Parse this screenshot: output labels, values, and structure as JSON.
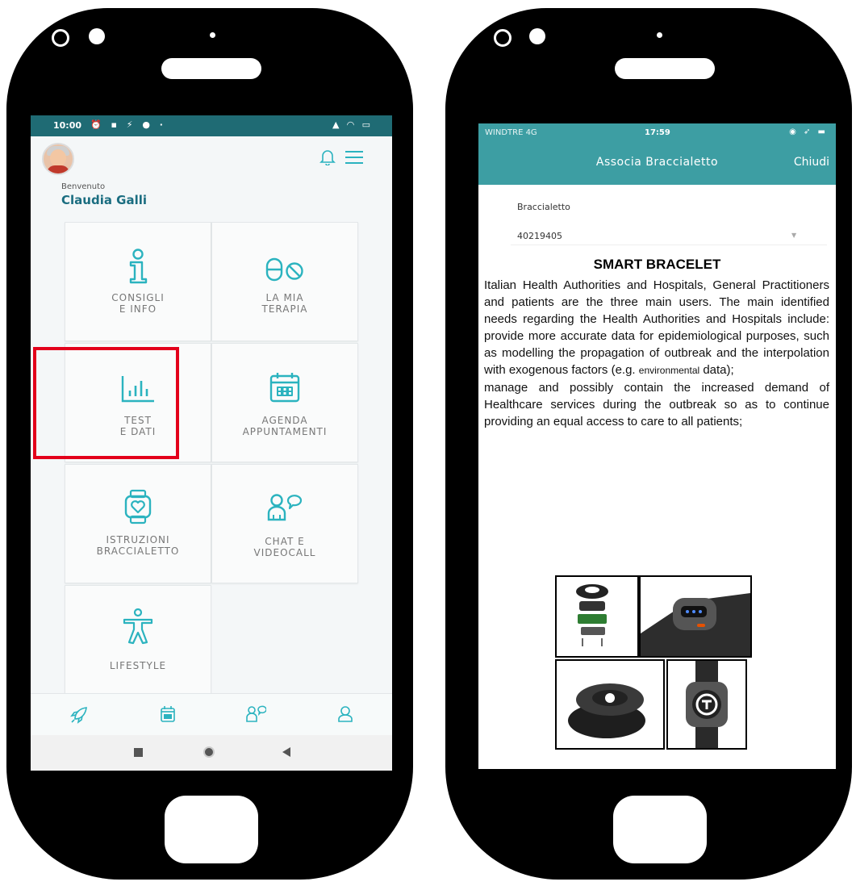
{
  "left_phone": {
    "status_bar": {
      "time": "10:00",
      "left_icons": "⏰ ▪ ⚡ ●  ·",
      "right_icons": "▲ ◠ ▭"
    },
    "header": {
      "welcome_label": "Benvenuto",
      "user_name": "Claudia Galli"
    },
    "tiles": [
      {
        "line1": "CONSIGLI",
        "line2": "E INFO",
        "icon": "info-icon"
      },
      {
        "line1": "LA MIA",
        "line2": "TERAPIA",
        "icon": "pill-icon"
      },
      {
        "line1": "TEST",
        "line2": "E DATI",
        "icon": "bar-chart-icon"
      },
      {
        "line1": "AGENDA",
        "line2": "APPUNTAMENTI",
        "icon": "calendar-icon"
      },
      {
        "line1": "ISTRUZIONI",
        "line2": "BRACCIALETTO",
        "icon": "smartwatch-icon",
        "highlighted": true
      },
      {
        "line1": "CHAT E",
        "line2": "VIDEOCALL",
        "icon": "chat-users-icon"
      },
      {
        "line1": "LIFESTYLE",
        "line2": "",
        "icon": "person-icon"
      }
    ],
    "bottom_nav": [
      "rocket-icon",
      "calendar-icon",
      "users-icon",
      "profile-icon"
    ],
    "accent_color": "#2bb3bf",
    "highlight_color": "#e3001b"
  },
  "right_phone": {
    "status_bar": {
      "carrier": "WINDTRE 4G",
      "time": "17:59",
      "right_icons": "◉ ➶ ▬"
    },
    "header": {
      "title": "Associa Braccialetto",
      "close_label": "Chiudi"
    },
    "field": {
      "label": "Braccialetto",
      "value": "40219405"
    },
    "overlay": {
      "title": "SMART BRACELET",
      "paragraph1_main": "Italian Health Authorities and Hospitals, General Practitioners and patients are the three main users. The main identified needs regarding the Health Authorities and Hospitals include: provide more accurate data for epidemiological purposes, such as modelling the propagation of outbreak and the interpolation with exogenous factors (e.g.",
      "paragraph1_small": "environmental",
      "paragraph1_end": "data);",
      "paragraph2": "manage and possibly contain the increased demand of Healthcare services during the outbreak so as to continue providing an equal access to care to all patients;"
    },
    "header_color": "#3d9ea3"
  }
}
